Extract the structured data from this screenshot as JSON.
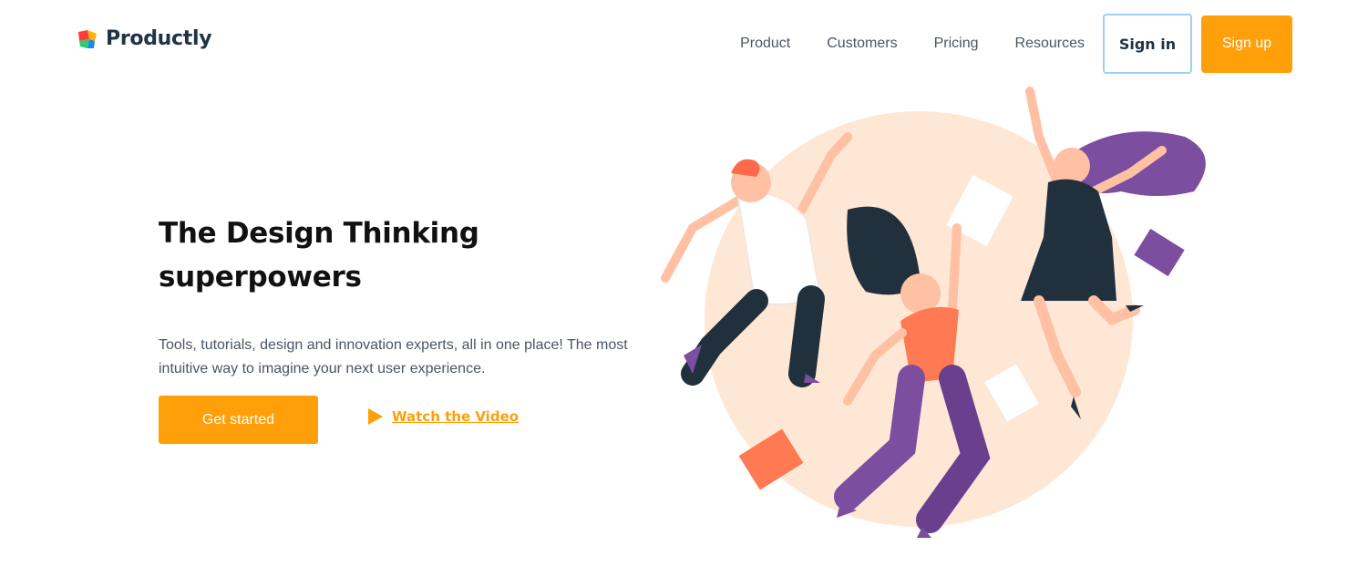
{
  "brand": {
    "name": "Productly"
  },
  "nav": {
    "links": [
      "Product",
      "Customers",
      "Pricing",
      "Resources"
    ],
    "sign_in": "Sign in",
    "sign_up": "Sign up"
  },
  "hero": {
    "title_line1": "The Design Thinking",
    "title_line2": "superpowers",
    "description": "Tools, tutorials, design and innovation experts, all in one place! The most intuitive way to imagine your next user experience.",
    "cta": "Get started",
    "video_link": "Watch the Video"
  },
  "colors": {
    "accent": "#ff9f0a",
    "dark": "#1e3446",
    "blob": "#ffe7d6",
    "purple": "#7b4ea0",
    "coral": "#ff7a52"
  },
  "icons": [
    "logo-icon",
    "play-icon"
  ]
}
